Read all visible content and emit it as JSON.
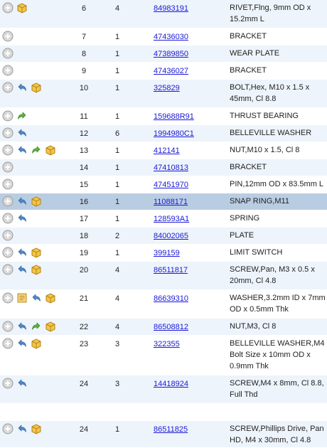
{
  "rows": [
    {
      "icons": [
        "add-icon",
        "box-icon"
      ],
      "seq": "6",
      "qty": "4",
      "part": "84983191",
      "desc": "RIVET,Flng, 9mm OD x 15.2mm L"
    },
    {
      "icons": [
        "add-icon"
      ],
      "seq": "7",
      "qty": "1",
      "part": "47436030",
      "desc": "BRACKET"
    },
    {
      "icons": [
        "add-icon"
      ],
      "seq": "8",
      "qty": "1",
      "part": "47389850",
      "desc": "WEAR PLATE"
    },
    {
      "icons": [
        "add-icon"
      ],
      "seq": "9",
      "qty": "1",
      "part": "47436027",
      "desc": "BRACKET"
    },
    {
      "icons": [
        "add-icon",
        "return-arrow-icon",
        "box-icon"
      ],
      "seq": "10",
      "qty": "1",
      "part": "325829",
      "desc": "BOLT,Hex, M10 x 1.5 x 45mm, Cl 8.8"
    },
    {
      "icons": [
        "add-icon",
        "green-arrow-icon"
      ],
      "seq": "11",
      "qty": "1",
      "part": "159688R91",
      "desc": "THRUST BEARING"
    },
    {
      "icons": [
        "add-icon",
        "return-arrow-icon"
      ],
      "seq": "12",
      "qty": "6",
      "part": "1994980C1",
      "desc": "BELLEVILLE WASHER"
    },
    {
      "icons": [
        "add-icon",
        "return-arrow-icon",
        "green-arrow-icon",
        "box-icon"
      ],
      "seq": "13",
      "qty": "1",
      "part": "412141",
      "desc": "NUT,M10 x 1.5, Cl 8"
    },
    {
      "icons": [
        "add-icon"
      ],
      "seq": "14",
      "qty": "1",
      "part": "47410813",
      "desc": "BRACKET"
    },
    {
      "icons": [
        "add-icon"
      ],
      "seq": "15",
      "qty": "1",
      "part": "47451970",
      "desc": "PIN,12mm OD x 83.5mm L"
    },
    {
      "icons": [
        "add-icon",
        "return-arrow-icon",
        "box-icon"
      ],
      "seq": "16",
      "qty": "1",
      "part": "11088171",
      "desc": "SNAP RING,M11",
      "selected": true
    },
    {
      "icons": [
        "add-icon",
        "return-arrow-icon"
      ],
      "seq": "17",
      "qty": "1",
      "part": "128593A1",
      "desc": "SPRING"
    },
    {
      "icons": [
        "add-icon"
      ],
      "seq": "18",
      "qty": "2",
      "part": "84002065",
      "desc": "PLATE"
    },
    {
      "icons": [
        "add-icon",
        "return-arrow-icon",
        "box-icon"
      ],
      "seq": "19",
      "qty": "1",
      "part": "399159",
      "desc": "LIMIT SWITCH"
    },
    {
      "icons": [
        "add-icon",
        "return-arrow-icon",
        "box-icon"
      ],
      "seq": "20",
      "qty": "4",
      "part": "86511817",
      "desc": "SCREW,Pan, M3 x 0.5 x 20mm, Cl 4.8"
    },
    {
      "icons": [
        "add-icon",
        "note-icon",
        "return-arrow-icon",
        "box-icon"
      ],
      "seq": "21",
      "qty": "4",
      "part": "86639310",
      "desc": "WASHER,3.2mm ID x 7mm OD x 0.5mm Thk"
    },
    {
      "icons": [
        "add-icon",
        "return-arrow-icon",
        "green-arrow-icon",
        "box-icon"
      ],
      "seq": "22",
      "qty": "4",
      "part": "86508812",
      "desc": "NUT,M3, Cl 8"
    },
    {
      "icons": [
        "add-icon",
        "return-arrow-icon",
        "box-icon"
      ],
      "seq": "23",
      "qty": "3",
      "part": "322355",
      "desc": "BELLEVILLE WASHER,M4 Bolt Size x 10mm OD x 0.9mm Thk"
    },
    {
      "icons": [
        "add-icon",
        "return-arrow-icon"
      ],
      "seq": "24",
      "qty": "3",
      "part": "14418924",
      "desc": "SCREW,M4 x 8mm, Cl 8.8, Full Thd"
    },
    {
      "icons": [],
      "seq": "",
      "qty": "",
      "part": "",
      "desc": ""
    },
    {
      "icons": [
        "add-icon",
        "return-arrow-icon",
        "box-icon"
      ],
      "seq": "24",
      "qty": "1",
      "part": "86511825",
      "desc": "SCREW,Phillips Drive, Pan HD, M4 x 30mm, Cl 4.8"
    }
  ],
  "colors": {
    "row_alt": "#eef4fb",
    "row_selected": "#b9cde2",
    "link": "#1a1ad6"
  }
}
